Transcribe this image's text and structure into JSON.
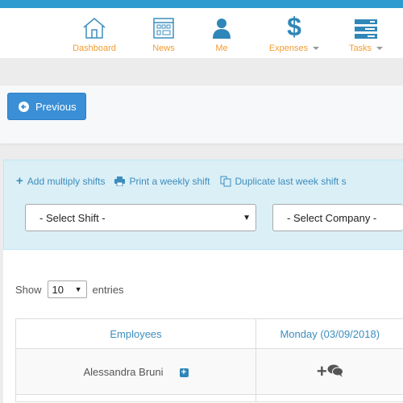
{
  "nav": {
    "items": [
      {
        "label": "Dashboard",
        "icon": "home-icon"
      },
      {
        "label": "News",
        "icon": "news-icon"
      },
      {
        "label": "Me",
        "icon": "user-icon"
      },
      {
        "label": "Expenses",
        "icon": "dollar-icon",
        "dropdown": true
      },
      {
        "label": "Tasks",
        "icon": "tasks-icon",
        "dropdown": true
      }
    ]
  },
  "toolbar": {
    "previous_label": "Previous"
  },
  "actions": {
    "add": "Add multiply shifts",
    "print": "Print a weekly shift",
    "duplicate": "Duplicate last week shift s"
  },
  "filters": {
    "shift": "- Select Shift -",
    "company": "- Select Company -"
  },
  "table": {
    "show_label": "Show",
    "entries_value": "10",
    "entries_label": "entries",
    "headers": [
      "Employees",
      "Monday (03/09/2018)"
    ],
    "rows": [
      {
        "employee": "Alessandra Bruni"
      }
    ]
  },
  "colors": {
    "accent": "#2e9bd0",
    "nav_text": "#f39c33",
    "button": "#3a8fd6"
  }
}
